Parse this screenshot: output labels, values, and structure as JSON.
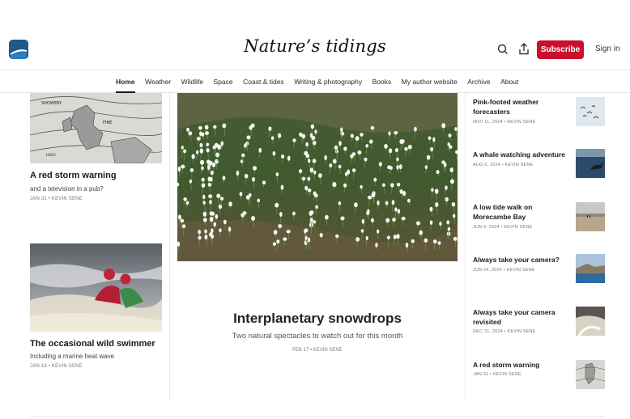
{
  "header": {
    "site_title": "Nature’s tidings",
    "subscribe_label": "Subscribe",
    "signin_label": "Sign in",
    "icons": [
      "logo",
      "search-icon",
      "share-icon"
    ]
  },
  "nav": {
    "items": [
      "Home",
      "Weather",
      "Wildlife",
      "Space",
      "Coast & tides",
      "Writing & photography",
      "Books",
      "My author website",
      "Archive",
      "About"
    ],
    "active": "Home"
  },
  "left": [
    {
      "title": "A red storm warning",
      "subtitle": "and a television in a pub?",
      "meta": "JAN 31 • KEVIN SENE"
    },
    {
      "title": "The occasional wild swimmer",
      "subtitle": "Including a marine heat wave",
      "meta": "JAN 18 • KEVIN SENE"
    }
  ],
  "featured": {
    "title": "Interplanetary snowdrops",
    "subtitle": "Two natural spectacles to watch out for this month",
    "meta": "FEB 17 • KEVIN SENE"
  },
  "right": [
    {
      "title": "Pink-footed weather forecasters",
      "meta": "NOV 11, 2024 • KEVIN SENE"
    },
    {
      "title": "A whale watching adventure",
      "meta": "AUG 6, 2024 • KEVIN SENE"
    },
    {
      "title": "A low tide walk on Morecambe Bay",
      "meta": "JUN 9, 2024 • KEVIN SENE"
    },
    {
      "title": "Always take your camera?",
      "meta": "JUN 24, 2024 • KEVIN SENE"
    },
    {
      "title": "Always take your camera revisited",
      "meta": "DEC 31, 2024 • KEVIN SENE"
    },
    {
      "title": "A red storm warning",
      "meta": "JAN 31 • KEVIN SENE"
    }
  ],
  "colors": {
    "brand": "#1f5a8a",
    "subscribe": "#c8102e"
  }
}
